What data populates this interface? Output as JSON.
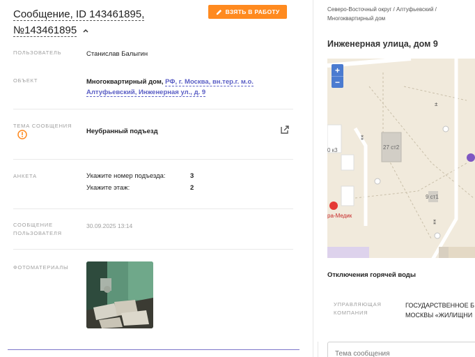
{
  "header": {
    "title": "Сообщение, ID 143461895, №143461895",
    "take_button": "ВЗЯТЬ В РАБОТУ"
  },
  "fields": {
    "user_label": "ПОЛЬЗОВАТЕЛЬ",
    "user_value": "Станислав Балыгин",
    "object_label": "ОБЪЕКТ",
    "object_type": "Многоквартирный дом,",
    "object_address": "РФ, г. Москва, вн.тер.г. м.о. Алтуфьевский, Инженерная ул., д. 9",
    "topic_label": "ТЕМА СООБЩЕНИЯ",
    "topic_value": "Неубранный подъезд",
    "survey_label": "АНКЕТА",
    "survey_items": [
      {
        "q": "Укажите номер подъезда:",
        "a": "3"
      },
      {
        "q": "Укажите этаж:",
        "a": "2"
      }
    ],
    "message_label": "СООБЩЕНИЕ ПОЛЬЗОВАТЕЛЯ",
    "message_value": "30.09.2025 13:14",
    "photos_label": "ФОТОМАТЕРИАЛЫ"
  },
  "right": {
    "breadcrumb": "Северо-Восточный округ / Алтуфьевский / Многоквартирный дом",
    "address_title": "Инженерная улица, дом 9",
    "map_labels": [
      "27 ст2",
      "9 ст1",
      "0 к3",
      "ра-Медик"
    ],
    "zoom_in": "+",
    "zoom_out": "−",
    "outage_title": "Отключения горячей воды",
    "uk_label": "УПРАВЛЯЮЩАЯ КОМПАНИЯ",
    "uk_value_line1": "ГОСУДАРСТВЕННОЕ Б",
    "uk_value_line2": "МОСКВЫ «ЖИЛИЩНИ",
    "subject_placeholder": "Тема сообщения"
  },
  "colors": {
    "accent_orange": "#ff8a1f",
    "link_purple": "#5a5ec5",
    "map_zoom": "#4b7bd0"
  }
}
